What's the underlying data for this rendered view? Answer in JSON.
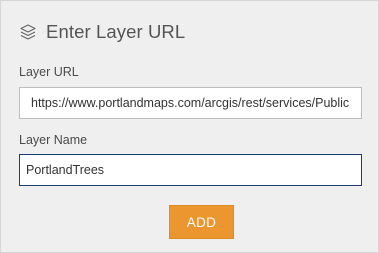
{
  "header": {
    "title": "Enter Layer URL",
    "icon": "layers-icon"
  },
  "form": {
    "url_label": "Layer URL",
    "url_value": "https://www.portlandmaps.com/arcgis/rest/services/Public",
    "name_label": "Layer Name",
    "name_value": "PortlandTrees",
    "add_label": "ADD"
  },
  "colors": {
    "panel_background": "#efefef",
    "button": "#ec962f",
    "focused_border": "#1f3f6e"
  }
}
